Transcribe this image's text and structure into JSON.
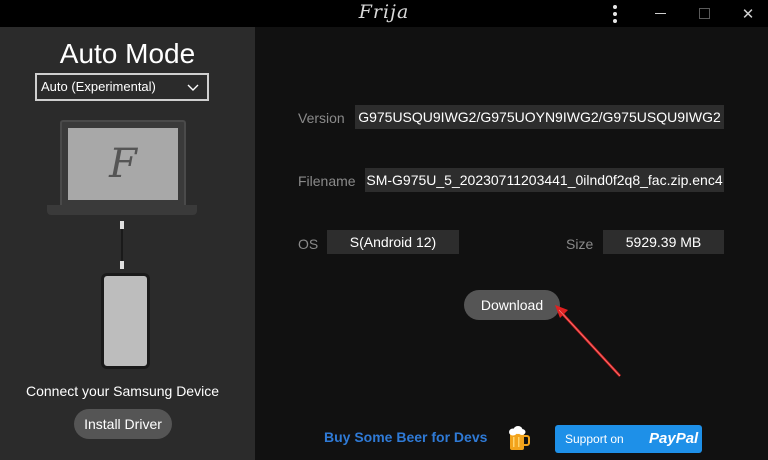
{
  "window": {
    "title": "Frija",
    "menu_icon": "kebab-menu-icon",
    "minimize_icon": "minimize-icon",
    "maximize_icon": "maximize-icon",
    "close_icon": "close-icon",
    "close_glyph": "✕"
  },
  "left": {
    "mode_title": "Auto Mode",
    "mode_select": {
      "value": "Auto (Experimental)",
      "chevron_glyph": "⌵"
    },
    "laptop_logo": "F",
    "connect_text": "Connect your Samsung Device",
    "install_button": "Install Driver"
  },
  "fields": {
    "version": {
      "label": "Version",
      "value": "G975USQU9IWG2/G975UOYN9IWG2/G975USQU9IWG2"
    },
    "filename": {
      "label": "Filename",
      "value": "SM-G975U_5_20230711203441_0ilnd0f2q8_fac.zip.enc4"
    },
    "os": {
      "label": "OS",
      "value": "S(Android 12)"
    },
    "size": {
      "label": "Size",
      "value": "5929.39 MB"
    }
  },
  "download_button": "Download",
  "footer": {
    "beer_text": "Buy Some Beer for Devs",
    "beer_icon": "beer-mug-icon",
    "paypal_support": "Support on",
    "paypal_brand": "PayPal"
  },
  "colors": {
    "accent_blue": "#2f7ad6",
    "paypal_blue": "#1e90e8",
    "arrow_red": "#e02020"
  }
}
